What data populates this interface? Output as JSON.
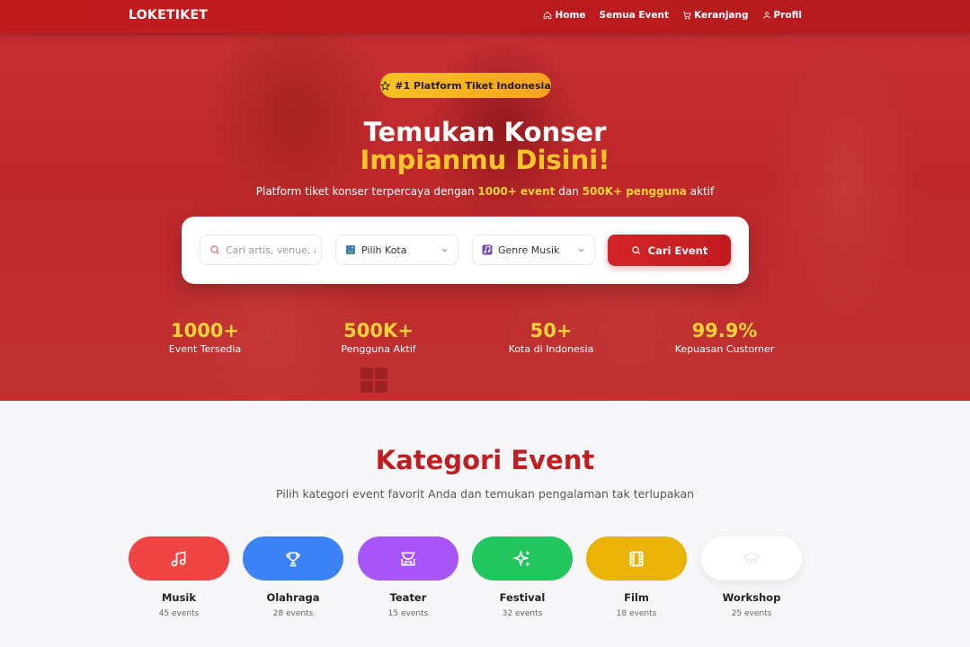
{
  "nav": {
    "logo": "LOKETIKET",
    "links": [
      "Home",
      "Semua Event",
      "Keranjang",
      "Profil"
    ]
  },
  "hero": {
    "badge": "#1 Platform Tiket Indonesia",
    "title_line1": "Temukan Konser",
    "title_line2": "Impianmu Disini!",
    "subtitle_pre": "Platform tiket konser terpercaya dengan ",
    "subtitle_hl1": "1000+ event",
    "subtitle_mid": " dan ",
    "subtitle_hl2": "500K+ pengguna",
    "subtitle_post": " aktif"
  },
  "search": {
    "placeholder": "Cari artis, venue, atau event...",
    "city": "Pilih Kota",
    "genre": "Genre Musik",
    "button": "Cari Event"
  },
  "stats": [
    {
      "value": "1000+",
      "label": "Event Tersedia"
    },
    {
      "value": "500K+",
      "label": "Pengguna Aktif"
    },
    {
      "value": "50+",
      "label": "Kota di Indonesia"
    },
    {
      "value": "99.9%",
      "label": "Kepuasan Customer"
    }
  ],
  "categories": {
    "title": "Kategori Event",
    "subtitle": "Pilih kategori event favorit Anda dan temukan pengalaman tak terlupakan",
    "items": [
      {
        "name": "Musik",
        "count": "45 events",
        "color": "#ef4444",
        "icon": "music-icon"
      },
      {
        "name": "Olahraga",
        "count": "28 events",
        "color": "#3b82f6",
        "icon": "trophy-icon"
      },
      {
        "name": "Teater",
        "count": "15 events",
        "color": "#a855f7",
        "icon": "theater-icon"
      },
      {
        "name": "Festival",
        "count": "32 events",
        "color": "#22c55e",
        "icon": "sparkles-icon"
      },
      {
        "name": "Film",
        "count": "18 events",
        "color": "#eab308",
        "icon": "film-icon"
      },
      {
        "name": "Workshop",
        "count": "25 events",
        "color": "#ffffff",
        "icon": "graduation-cap-icon"
      }
    ]
  },
  "colors": {
    "primary": "#c11d1f",
    "accent": "#ffd23a"
  }
}
